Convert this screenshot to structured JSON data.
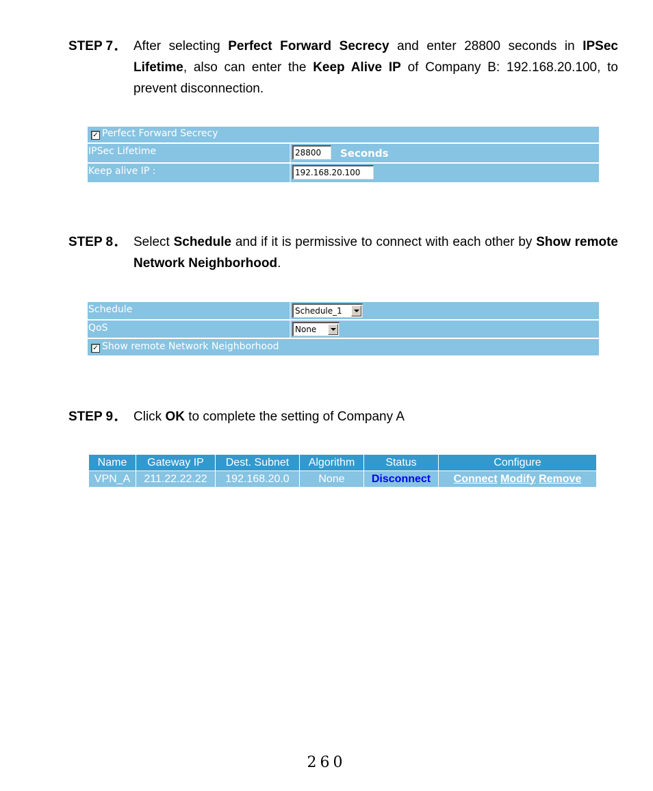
{
  "steps": [
    {
      "label": "STEP 7．",
      "parts": [
        {
          "t": "After selecting ",
          "b": false
        },
        {
          "t": "Perfect Forward Secrecy",
          "b": true
        },
        {
          "t": " and enter 28800 seconds in ",
          "b": false
        },
        {
          "t": "IPSec Lifetime",
          "b": true
        },
        {
          "t": ", also can enter the ",
          "b": false
        },
        {
          "t": "Keep Alive IP",
          "b": true
        },
        {
          "t": " of Company B: 192.168.20.100, to prevent disconnection.",
          "b": false
        }
      ]
    },
    {
      "label": "STEP 8．",
      "parts": [
        {
          "t": "Select ",
          "b": false
        },
        {
          "t": "Schedule",
          "b": true
        },
        {
          "t": " and if it is permissive to connect with each other by ",
          "b": false
        },
        {
          "t": "Show remote Network Neighborhood",
          "b": true
        },
        {
          "t": ".",
          "b": false
        }
      ]
    },
    {
      "label": "STEP 9．",
      "parts": [
        {
          "t": "Click ",
          "b": false
        },
        {
          "t": "OK",
          "b": true
        },
        {
          "t": " to complete the setting of Company A",
          "b": false
        }
      ]
    }
  ],
  "security_panel": {
    "pfs_label": "Perfect Forward Secrecy",
    "pfs_checked": true,
    "lifetime_label": "IPSec Lifetime",
    "lifetime_value": "28800",
    "lifetime_unit": "Seconds",
    "keepalive_label": "Keep alive IP :",
    "keepalive_value": "192.168.20.100"
  },
  "schedule_panel": {
    "schedule_label": "Schedule",
    "schedule_value": "Schedule_1",
    "qos_label": "QoS",
    "qos_value": "None",
    "neighborhood_label": "Show remote Network Neighborhood",
    "neighborhood_checked": true
  },
  "vpn_table": {
    "headers": [
      "Name",
      "Gateway IP",
      "Dest. Subnet",
      "Algorithm",
      "Status",
      "Configure"
    ],
    "rows": [
      {
        "name": "VPN_A",
        "gateway_ip": "211.22.22.22",
        "dest_subnet": "192.168.20.0",
        "algorithm": "None",
        "status": "Disconnect",
        "actions": [
          "Connect",
          "Modify",
          "Remove"
        ]
      }
    ]
  },
  "colors": {
    "panel_bg": "#87c3e2",
    "header_bg": "#3399cc",
    "status_link": "#0000ff"
  },
  "page_number": "260"
}
